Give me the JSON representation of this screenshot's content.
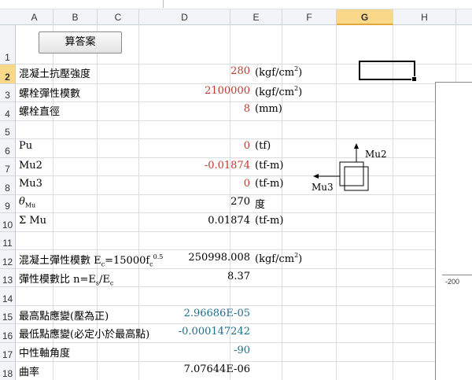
{
  "columns": [
    "A",
    "B",
    "C",
    "D",
    "E",
    "F",
    "G",
    "H"
  ],
  "selected_column": "G",
  "rows": [
    "1",
    "2",
    "3",
    "4",
    "5",
    "6",
    "7",
    "8",
    "9",
    "10",
    "11",
    "12",
    "13",
    "14",
    "15",
    "16",
    "17",
    "18"
  ],
  "selected_row": "2",
  "button": {
    "label": "算答案"
  },
  "cells": {
    "r2": {
      "label": "混凝土抗壓強度",
      "value": "280",
      "unit": "(kgf/cm",
      "unit_sup": "2",
      "unit_end": ")"
    },
    "r3": {
      "label": "螺栓彈性模數",
      "value": "2100000",
      "unit": "(kgf/cm",
      "unit_sup": "2",
      "unit_end": ")"
    },
    "r4": {
      "label": "螺栓直徑",
      "value": "8",
      "unit": "(mm)"
    },
    "r6": {
      "label": "Pu",
      "value": "0",
      "unit": "(tf)"
    },
    "r7": {
      "label": "Mu2",
      "value": "-0.01874",
      "unit": "(tf-m)"
    },
    "r8": {
      "label": "Mu3",
      "value": "0",
      "unit": "(tf-m)"
    },
    "r9": {
      "label_main": "θ",
      "label_sub": "Mu",
      "value": "270",
      "unit": "度"
    },
    "r10": {
      "label": "Σ Mu",
      "value": "0.01874",
      "unit": "(tf-m)"
    },
    "r12": {
      "label": "混凝土彈性模數 E",
      "label_sub1": "c",
      "label_mid": "=15000f",
      "label_sub2": "c",
      "label_sup": "0.5",
      "value": "250998.008",
      "unit": "(kgf/cm",
      "unit_sup": "2",
      "unit_end": ")"
    },
    "r13": {
      "label": "彈性模數比 n=E",
      "label_sub1": "s",
      "label_mid": "/E",
      "label_sub2": "c",
      "value": "8.37"
    },
    "r15": {
      "label": "最高點應變(壓為正)",
      "value": "2.96686E-05"
    },
    "r16": {
      "label": "最低點應變(必定小於最高點)",
      "value": "-0.000147242"
    },
    "r17": {
      "label": "中性軸角度",
      "value": "-90"
    },
    "r18": {
      "label": "曲率",
      "value": "7.07644E-06"
    }
  },
  "diagram": {
    "mu2_label": "Mu2",
    "mu3_label": "Mu3"
  },
  "chart": {
    "tick_label": "-200"
  },
  "colors": {
    "input_value": "#c0392b",
    "calc_value": "#1f6f8b",
    "selection": "#f9d88a"
  }
}
